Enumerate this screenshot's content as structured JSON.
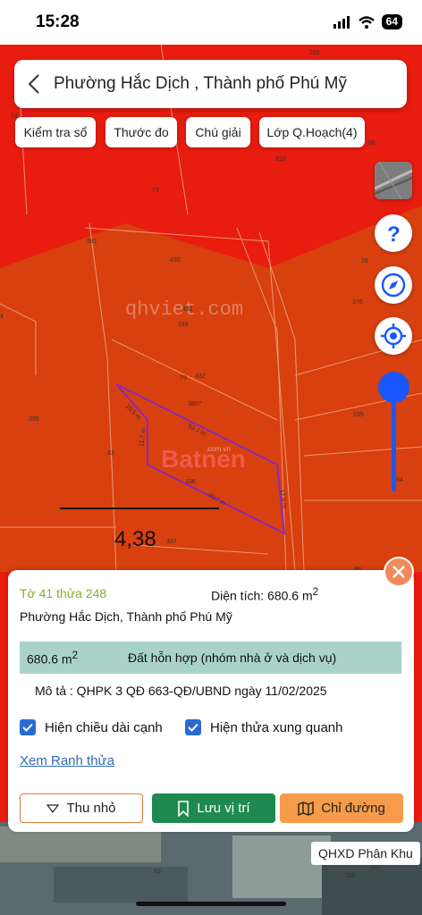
{
  "status": {
    "time": "15:28",
    "battery": "64"
  },
  "search": {
    "title": "Phường Hắc Dịch , Thành phố Phú Mỹ"
  },
  "chips": {
    "check_book": "Kiểm tra sổ",
    "measure": "Thước đo",
    "legend": "Chú giải",
    "layer": "Lớp Q.Hoạch(4)"
  },
  "map": {
    "watermark": "qhviet.com",
    "logo_text": "Batnen",
    "logo_sub": ".com.vn",
    "scale_value": "4,38",
    "edge_labels": [
      "10.5 m",
      "53.1 m",
      "17.6 m",
      "40.7 m",
      "11.7 m"
    ],
    "parcel_numbers": [
      "209",
      "74",
      "210",
      "66",
      "73",
      "381",
      "430",
      "78",
      "376",
      "431",
      "249",
      "432",
      "79",
      "3807",
      "335",
      "83",
      "336",
      "155",
      "84",
      "337",
      "93",
      "287",
      "286",
      "88",
      "4"
    ],
    "colors": {
      "zone_red": "#e81c0f",
      "zone_orange": "#d8400f",
      "parcel_outline": "#8a2bb5",
      "accent_blue": "#1a57ff"
    }
  },
  "info": {
    "parcel_id": "Tờ 41 thửa 248",
    "area_label": "Diện tích: 680.6 m",
    "area_sup": "2",
    "address": "Phường Hắc Dịch, Thành phố Phú Mỹ",
    "land_area": "680.6 m",
    "land_area_sup": "2",
    "land_type": "Đất hỗn hợp (nhóm nhà ở và dịch vụ)",
    "description": "Mô tả : QHPK 3 QĐ 663-QĐ/UBND ngày 11/02/2025",
    "check_edges": "Hiện chiều dài cạnh",
    "check_neighbors": "Hiện thửa xung quanh",
    "link_boundary": "Xem Ranh thửa",
    "btn_collapse": "Thu nhỏ",
    "btn_save": "Lưu vị trí",
    "btn_direction": "Chỉ đường"
  },
  "badge": {
    "qhxd": "QHXD Phân Khu"
  }
}
